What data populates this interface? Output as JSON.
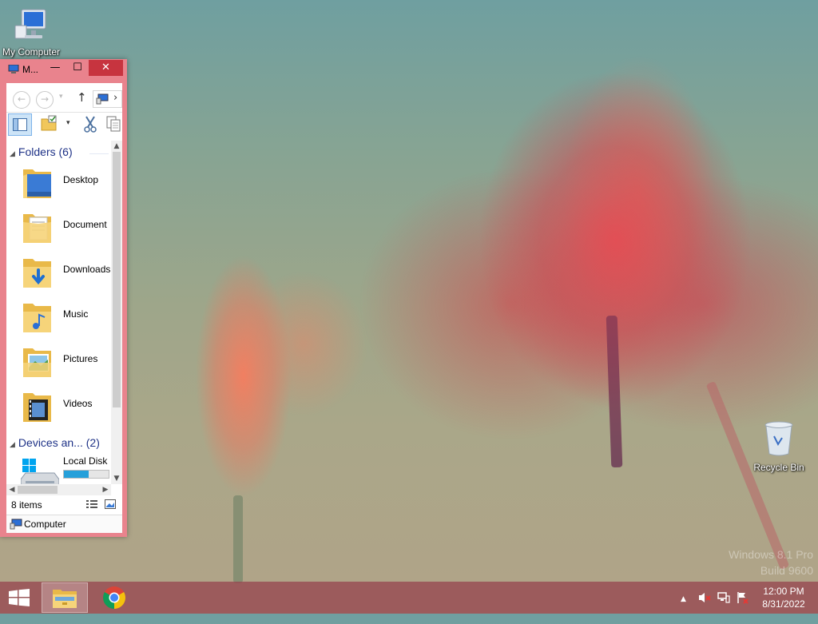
{
  "wallpaper": {
    "watermark_line1": "Windows 8.1 Pro",
    "watermark_line2": "Build 9600"
  },
  "desktop": {
    "icons": [
      {
        "label": "My Computer",
        "icon": "computer-icon"
      },
      {
        "label": "Recycle Bin",
        "icon": "recycle-bin-icon"
      }
    ]
  },
  "window": {
    "title": "M...",
    "minimize_glyph": "—",
    "maximize_glyph": "☐",
    "close_glyph": "✕",
    "nav": {
      "back_glyph": "←",
      "forward_glyph": "→",
      "recent_glyph": "▾",
      "up_glyph": "↑",
      "chevron_glyph": "›"
    },
    "groups": [
      {
        "label": "Folders",
        "count": "(6)"
      },
      {
        "label": "Devices an...",
        "count": "(2)"
      }
    ],
    "folders": [
      {
        "label": "Desktop",
        "icon": "desktop-folder-icon"
      },
      {
        "label": "Document",
        "icon": "documents-folder-icon"
      },
      {
        "label": "Downloads",
        "icon": "downloads-folder-icon"
      },
      {
        "label": "Music",
        "icon": "music-folder-icon"
      },
      {
        "label": "Pictures",
        "icon": "pictures-folder-icon"
      },
      {
        "label": "Videos",
        "icon": "videos-folder-icon"
      }
    ],
    "devices": [
      {
        "label": "Local Disk",
        "icon": "local-disk-icon",
        "usage_fraction": 0.55
      }
    ],
    "status": {
      "items": "8 items"
    },
    "address": {
      "label": "Computer"
    }
  },
  "taskbar": {
    "clock": {
      "time": "12:00 PM",
      "date": "8/31/2022"
    },
    "accent": "#964650"
  }
}
